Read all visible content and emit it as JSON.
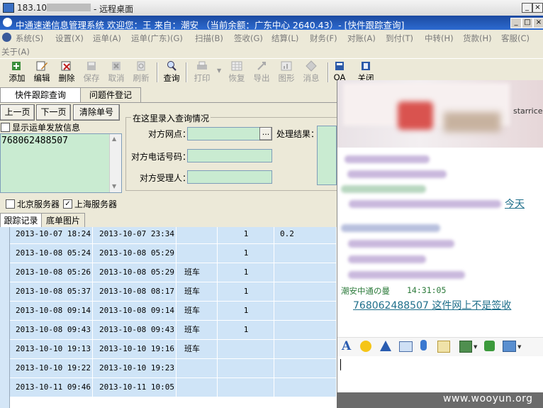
{
  "remote_window": {
    "title": "183.10.",
    "title_suffix": "- 远程桌面"
  },
  "app": {
    "title": "中通速递信息管理系统  欢迎您：王  来自：潮安  （当前余额：广东中心 2640.43）- [快件跟踪查询]"
  },
  "menu": {
    "items": [
      "系统(S)",
      "设置(X)",
      "运单(A)",
      "运单(广东)(G)",
      "扫描(B)",
      "签收(G)",
      "结算(L)",
      "财务(F)",
      "对账(A)",
      "到付(T)",
      "中转(H)",
      "货款(H)",
      "客服(C)"
    ],
    "second_line": "关于(A)"
  },
  "toolbar": {
    "buttons": [
      {
        "label": "添加",
        "icon": "add-icon",
        "enabled": true
      },
      {
        "label": "编辑",
        "icon": "edit-icon",
        "enabled": true
      },
      {
        "label": "删除",
        "icon": "delete-icon",
        "enabled": true
      },
      {
        "label": "保存",
        "icon": "save-icon",
        "enabled": false
      },
      {
        "label": "取消",
        "icon": "cancel-icon",
        "enabled": false
      },
      {
        "label": "刷新",
        "icon": "refresh-icon",
        "enabled": false
      },
      {
        "label": "查询",
        "icon": "search-icon",
        "enabled": true
      },
      {
        "label": "打印",
        "icon": "print-icon",
        "enabled": false
      },
      {
        "label": "恢复",
        "icon": "restore-icon",
        "enabled": false
      },
      {
        "label": "导出",
        "icon": "export-icon",
        "enabled": false
      },
      {
        "label": "图形",
        "icon": "chart-icon",
        "enabled": false
      },
      {
        "label": "消息",
        "icon": "message-icon",
        "enabled": false
      },
      {
        "label": "OA",
        "icon": "oa-icon",
        "enabled": true
      },
      {
        "label": "关闭",
        "icon": "close-icon",
        "enabled": true
      }
    ]
  },
  "tabs": {
    "track": "快件跟踪查询",
    "problem": "问题件登记"
  },
  "nav": {
    "prev": "上一页",
    "next": "下一页",
    "clear": "清除单号"
  },
  "show_sender_label": "显示运单发放信息",
  "waybill_number": "768062488507",
  "query": {
    "group_title": "在这里录入查询情况",
    "peer_site_label": "对方网点：",
    "peer_phone_label": "对方电话号码：",
    "peer_handler_label": "对方受理人：",
    "result_label": "处理结果：",
    "browse_label": "..."
  },
  "servers": {
    "beijing": "北京服务器",
    "shanghai": "上海服务器",
    "beijing_checked": false,
    "shanghai_checked": true
  },
  "sub_tabs": {
    "track_log": "跟踪记录",
    "bill_image": "底单图片"
  },
  "track_rows": [
    {
      "t1": "2013-10-07 18:24",
      "t2": "2013-10-07 23:34",
      "type": "",
      "n": "1",
      "extra": "0.2"
    },
    {
      "t1": "2013-10-08 05:24",
      "t2": "2013-10-08 05:29",
      "type": "",
      "n": "1",
      "extra": ""
    },
    {
      "t1": "2013-10-08 05:26",
      "t2": "2013-10-08 05:29",
      "type": "班车",
      "n": "1",
      "extra": ""
    },
    {
      "t1": "2013-10-08 05:37",
      "t2": "2013-10-08 08:17",
      "type": "班车",
      "n": "1",
      "extra": ""
    },
    {
      "t1": "2013-10-08 09:14",
      "t2": "2013-10-08 09:14",
      "type": "班车",
      "n": "1",
      "extra": ""
    },
    {
      "t1": "2013-10-08 09:43",
      "t2": "2013-10-08 09:43",
      "type": "班车",
      "n": "1",
      "extra": ""
    },
    {
      "t1": "2013-10-10 19:13",
      "t2": "2013-10-10 19:16",
      "type": "班车",
      "n": "",
      "extra": ""
    },
    {
      "t1": "2013-10-10 19:22",
      "t2": "2013-10-10 19:23",
      "type": "",
      "n": "",
      "extra": ""
    },
    {
      "t1": "2013-10-11 09:46",
      "t2": "2013-10-11 10:05",
      "type": "",
      "n": "",
      "extra": ""
    }
  ],
  "chat": {
    "header_fragment": "starrice.",
    "fragment_1": "今天",
    "sender": "潮安中通の曼",
    "time": "14:31:05",
    "message": "768062488507 这件网上不是签收"
  },
  "watermark": "www.wooyun.org",
  "colors": {
    "title_blue": "#1c4aa0",
    "field_green": "#c9ebd1",
    "row_blue": "#cfe4f7",
    "chat_sender": "#2b7a3a",
    "chat_link": "#1f6f8b"
  }
}
